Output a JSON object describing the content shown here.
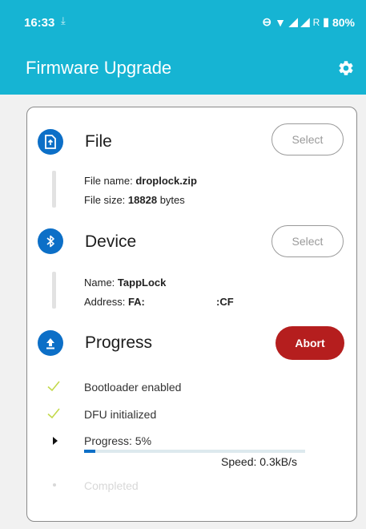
{
  "status_bar": {
    "time": "16:33",
    "battery": "80%",
    "network": "R"
  },
  "app_bar": {
    "title": "Firmware Upgrade"
  },
  "file": {
    "title": "File",
    "select_label": "Select",
    "name_label": "File name:",
    "name_value": "droplock.zip",
    "size_label": "File size:",
    "size_value": "18828",
    "size_unit": "bytes"
  },
  "device": {
    "title": "Device",
    "select_label": "Select",
    "name_label": "Name:",
    "name_value": "TappLock",
    "address_label": "Address:",
    "address_start": "FA:",
    "address_end": ":CF"
  },
  "progress": {
    "title": "Progress",
    "abort_label": "Abort",
    "steps": [
      "Bootloader enabled",
      "DFU initialized",
      "Progress: 5%",
      "Completed"
    ],
    "percent": 5,
    "speed": "Speed: 0.3kB/s"
  },
  "colors": {
    "accent": "#16b4d3",
    "icon_blue": "#0c6fc7",
    "abort_red": "#b51e1e",
    "check_green": "#c3d94b"
  }
}
